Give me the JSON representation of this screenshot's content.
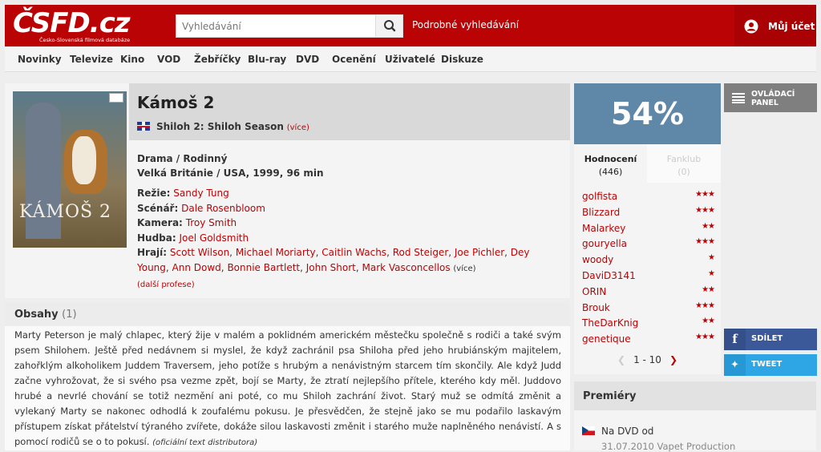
{
  "header": {
    "logo_text": "ČSFD.cz",
    "logo_subtitle": "Česko-Slovenská filmová databáze",
    "search_placeholder": "Vyhledávání",
    "advanced_search": "Podrobné vyhledávání",
    "account": "Můj účet",
    "accent_color": "#ba0305"
  },
  "nav": {
    "items": [
      "Novinky",
      "Televize",
      "Kino",
      "VOD",
      "Žebříčky",
      "Blu-ray",
      "DVD",
      "Ocenění",
      "Uživatelé",
      "Diskuze"
    ]
  },
  "film": {
    "title": "Kámoš 2",
    "poster_text": "KÁMOŠ 2",
    "original_title": "Shiloh 2: Shiloh Season",
    "more_link": "(více)",
    "genre": "Drama / Rodinný",
    "origin": "Velká Británie / USA, 1999, 96 min",
    "credits": {
      "directing_label": "Režie:",
      "directing": "Sandy Tung",
      "writing_label": "Scénář:",
      "writing": "Dale Rosenbloom",
      "camera_label": "Kamera:",
      "camera": "Troy Smith",
      "music_label": "Hudba:",
      "music": "Joel Goldsmith",
      "cast_label": "Hrají:",
      "cast": [
        "Scott Wilson",
        "Michael Moriarty",
        "Caitlin Wachs",
        "Rod Steiger",
        "Joe Pichler",
        "Dey Young",
        "Ann Dowd",
        "Bonnie Bartlett",
        "John Short",
        "Mark Vasconcellos"
      ],
      "cast_more": "(více)",
      "other_professions": "(další profese)"
    }
  },
  "obsahy": {
    "title": "Obsahy",
    "count": "(1)",
    "text": "Marty Peterson je malý chlapec, který žije v malém a poklidném americkém městečku společně s rodiči a také svým psem Shilohem. Ještě před nedávnem si myslel, že když zachránil psa Shiloha před jeho hrubiánským majitelem, zahořklým alkoholikem Juddem Traversem, jeho potíže s hrubým a nenávistným starcem tím skončily. Ale když Judd začne vyhrožovat, že si svého psa vezme zpět, bojí se Marty, že ztratí nejlepšího přítele, kterého kdy měl. Juddovo hrubé a nevrlé chování se totiž nezmění ani poté, co mu Shiloh zachrání život. Starý muž se odmítá změnit a vylekaný Marty se nakonec odhodlá k zoufalému pokusu. Je přesvědčen, že stejně jako se mu podařilo laskavým přístupem získat přátelství týraného zvířete, dokáže silou laskavosti změnit i starého muže naplněného nenávistí. A s pomocí rodičů se o to pokusí.",
    "source": "(oficiální text distributora)"
  },
  "rating": {
    "percent": "54%",
    "percent_value": 54,
    "box_color": "#5f87a8",
    "tab_ratings": "Hodnocení",
    "tab_ratings_count": "(446)",
    "tab_fanclub": "Fanklub",
    "tab_fanclub_count": "(0)",
    "users": [
      {
        "name": "golfista",
        "stars": "★★★"
      },
      {
        "name": "Blizzard",
        "stars": "★★★"
      },
      {
        "name": "Malarkey",
        "stars": "★★"
      },
      {
        "name": "gouryella",
        "stars": "★★★"
      },
      {
        "name": "woody",
        "stars": "★"
      },
      {
        "name": "DaviD3141",
        "stars": "★"
      },
      {
        "name": "ORIN",
        "stars": "★★"
      },
      {
        "name": "Brouk",
        "stars": "★★★"
      },
      {
        "name": "TheDarKnig",
        "stars": "★★"
      },
      {
        "name": "genetique",
        "stars": "★★★"
      }
    ],
    "pager": "1 - 10"
  },
  "side": {
    "panel_line1": "OVLÁDACÍ",
    "panel_line2": "PANEL",
    "share_facebook": "SDÍLET",
    "share_twitter": "TWEET"
  },
  "premiery": {
    "title": "Premiéry",
    "row": "Na DVD od",
    "row_sub": "31.07.2010 Vapet Production"
  }
}
